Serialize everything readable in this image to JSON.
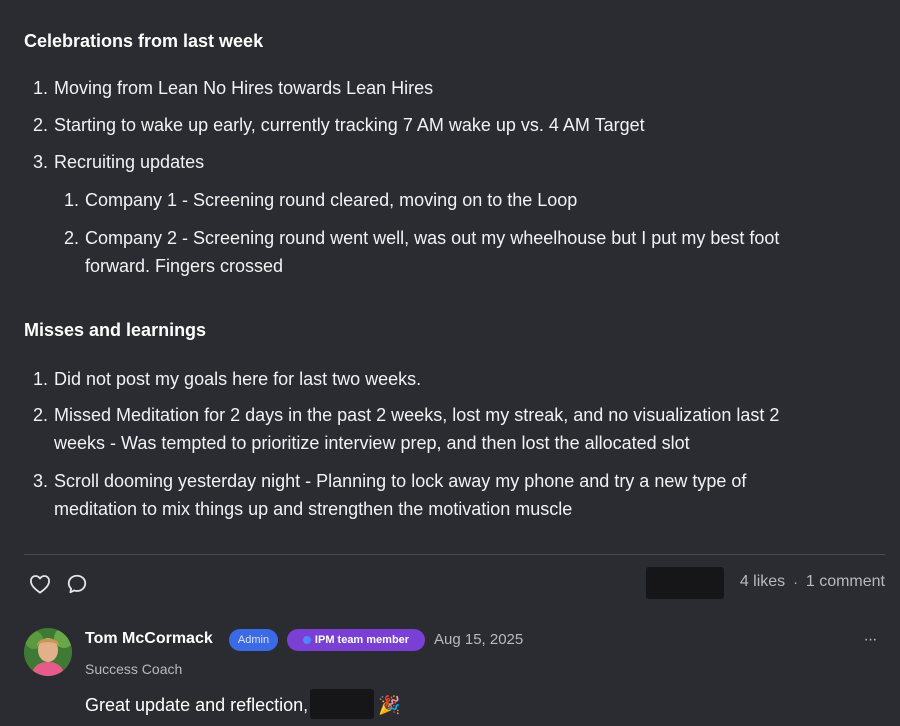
{
  "celebrations": {
    "title": "Celebrations from last week",
    "items": [
      {
        "num": "1.",
        "text": "Moving from Lean No Hires towards Lean Hires"
      },
      {
        "num": "2.",
        "text": "Starting to wake up early, currently tracking 7 AM wake up vs. 4 AM Target"
      },
      {
        "num": "3.",
        "text": "Recruiting updates"
      }
    ],
    "subitems": [
      {
        "num": "1.",
        "text": "Company 1 - Screening round cleared, moving on to the Loop"
      },
      {
        "num": "2.",
        "line1": "Company 2 - Screening round went well, was out my wheelhouse but I put my best foot",
        "line2": "forward. Fingers crossed"
      }
    ]
  },
  "misses": {
    "title": "Misses and learnings",
    "items": [
      {
        "num": "1.",
        "text": "Did not post my goals here for last two weeks."
      },
      {
        "num": "2.",
        "line1": "Missed Meditation for 2 days in the past 2 weeks, lost my streak, and no visualization last 2",
        "line2": "weeks - Was tempted to prioritize interview prep, and then lost the allocated slot"
      },
      {
        "num": "3.",
        "line1": "Scroll dooming yesterday night - Planning to lock away my phone and try a new type of",
        "line2": "meditation to mix things up and strengthen the motivation muscle"
      }
    ]
  },
  "footer": {
    "likes": "4 likes",
    "separator": "·",
    "comments": "1 comment",
    "icons": [
      "heart-icon",
      "comment-bubble-icon"
    ]
  },
  "comment": {
    "author": "Tom McCormack",
    "badge_admin": "Admin",
    "badge_team": "IPM team member",
    "date": "Aug 15, 2025",
    "role": "Success Coach",
    "text": "Great update and reflection,",
    "emoji": "🎉",
    "more": "···"
  },
  "colors": {
    "background": "#2b2c31",
    "admin_badge": "#3b6ae6",
    "team_badge": "#7a3fd4"
  }
}
